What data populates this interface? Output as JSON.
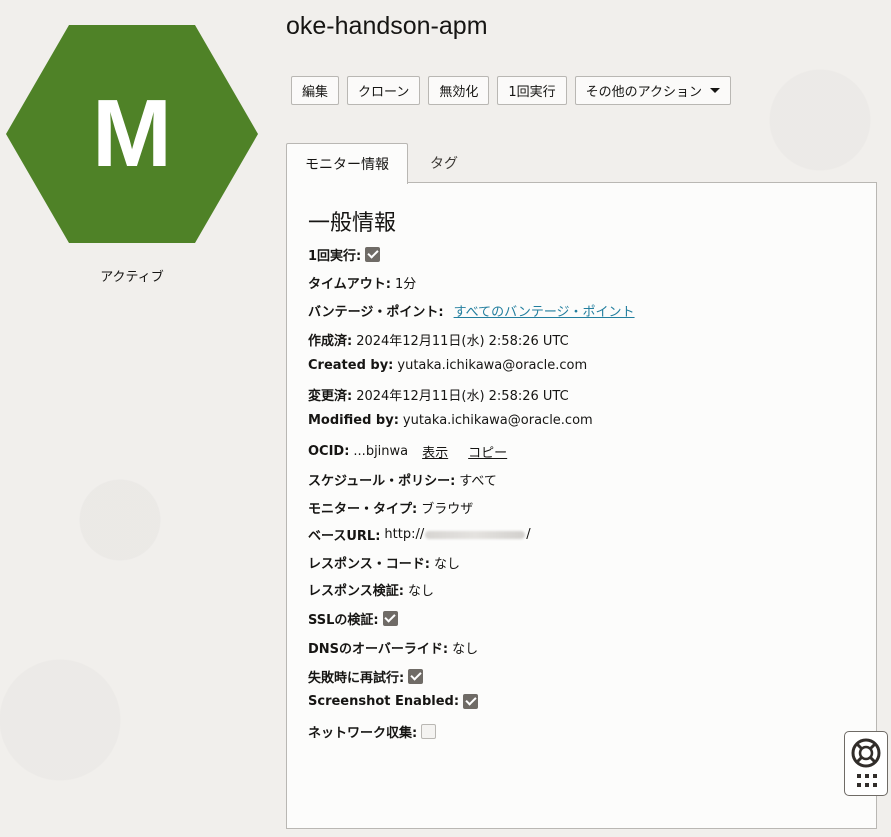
{
  "monitor": {
    "avatar_letter": "M",
    "avatar_color": "#4f8227",
    "status": "アクティブ",
    "title": "oke-handson-apm"
  },
  "actions": {
    "edit": "編集",
    "clone": "クローン",
    "disable": "無効化",
    "run_once": "1回実行",
    "more_actions": "その他のアクション"
  },
  "tabs": {
    "monitor_info": "モニター情報",
    "tags": "タグ"
  },
  "general_info": {
    "heading": "一般情報",
    "run_once_label": "1回実行:",
    "run_once_checked": true,
    "timeout_label": "タイムアウト:",
    "timeout_value": "1分",
    "vantage_label": "バンテージ・ポイント:",
    "vantage_link": "すべてのバンテージ・ポイント",
    "created_label": "作成済:",
    "created_value": "2024年12月11日(水) 2:58:26 UTC",
    "created_by_label": "Created by:",
    "created_by_value": "yutaka.ichikawa@oracle.com",
    "modified_label": "変更済:",
    "modified_value": "2024年12月11日(水) 2:58:26 UTC",
    "modified_by_label": "Modified by:",
    "modified_by_value": "yutaka.ichikawa@oracle.com",
    "ocid_label": "OCID:",
    "ocid_value": "...bjinwa",
    "ocid_show": "表示",
    "ocid_copy": "コピー",
    "schedule_label": "スケジュール・ポリシー:",
    "schedule_value": "すべて",
    "type_label": "モニター・タイプ:",
    "type_value": "ブラウザ",
    "base_url_label": "ベースURL:",
    "base_url_prefix": "http://",
    "base_url_suffix": "/",
    "response_code_label": "レスポンス・コード:",
    "response_code_value": "なし",
    "response_validation_label": "レスポンス検証:",
    "response_validation_value": "なし",
    "ssl_label": "SSLの検証:",
    "ssl_checked": true,
    "dns_label": "DNSのオーバーライド:",
    "dns_value": "なし",
    "retry_label": "失敗時に再試行:",
    "retry_checked": true,
    "screenshot_label": "Screenshot Enabled:",
    "screenshot_checked": true,
    "network_label": "ネットワーク収集:",
    "network_checked": false
  },
  "help_widget": {
    "icon": "lifebuoy-icon",
    "grid_icon": "grid-menu-icon"
  }
}
